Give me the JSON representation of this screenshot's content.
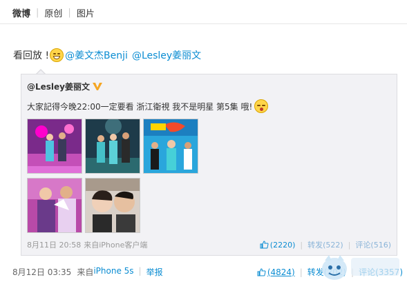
{
  "tabs": {
    "weibo": "微博",
    "original": "原创",
    "picture": "图片"
  },
  "post": {
    "text": "看回放 !",
    "mention1": "@姜文杰Benji",
    "mention2": "@Lesley姜丽文"
  },
  "repost": {
    "author": "@Lesley姜丽文",
    "text": "大家記得今晚22:00一定要看 浙江衛視 我不是明星 第5集 哦!",
    "time": "8月11日 20:58",
    "source_prefix": "来自",
    "source": "iPhone客户端",
    "like_count": "(2220)",
    "forward": "转发(522)",
    "comment": "评论(516)"
  },
  "footer": {
    "time": "8月12日 03:35",
    "source_prefix": "来自",
    "source": "iPhone 5s",
    "report": "举报",
    "like_count": "(4824)",
    "forward": "转发(202)",
    "comment": "评论(3357)"
  },
  "colors": {
    "link": "#0a8cd2",
    "repost_bg": "#f2f2f5"
  },
  "icons": [
    "smile-emoji-icon",
    "v-verified-icon",
    "blush-emoji-icon",
    "thumb-up-icon",
    "site-logo"
  ]
}
